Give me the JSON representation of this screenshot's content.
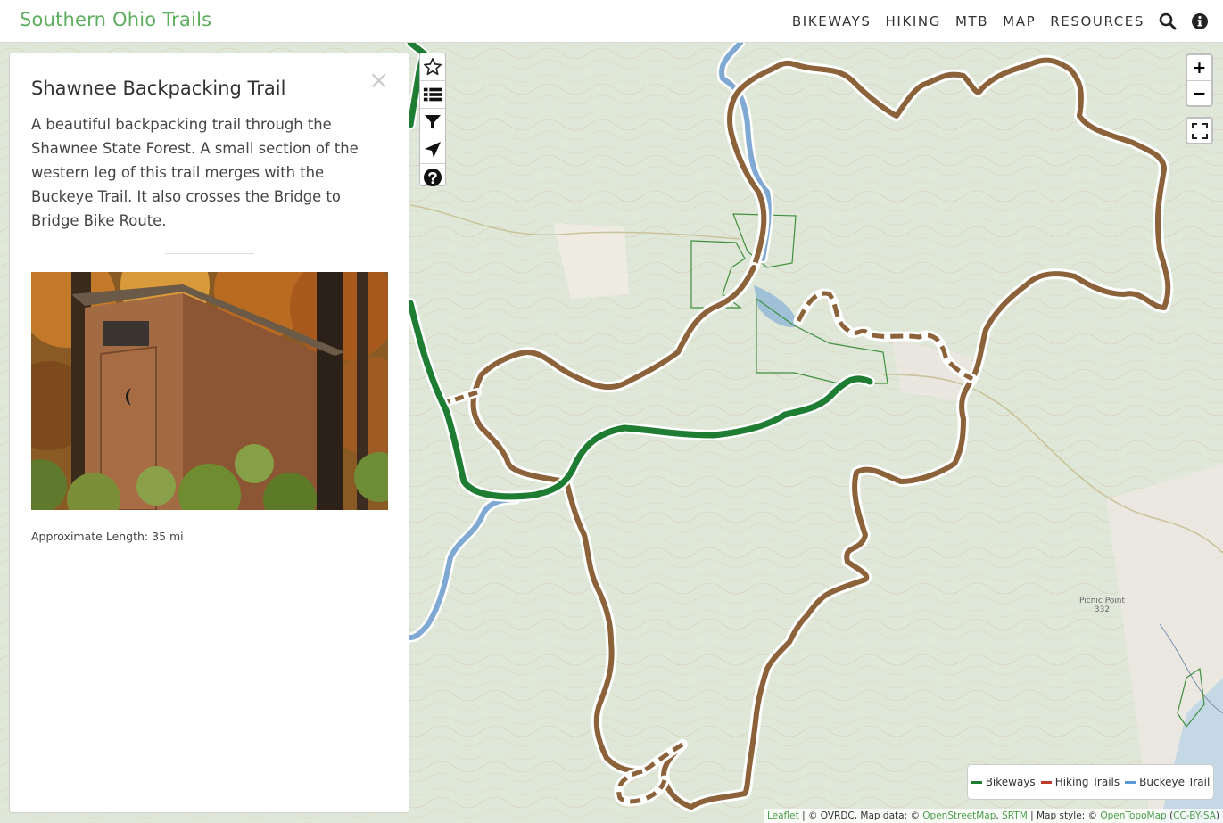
{
  "header": {
    "brand": "Southern Ohio Trails",
    "nav": [
      "BIKEWAYS",
      "HIKING",
      "MTB",
      "MAP",
      "RESOURCES"
    ],
    "icons": [
      "search-icon",
      "info-icon"
    ]
  },
  "panel": {
    "title": "Shawnee Backpacking Trail",
    "close": "×",
    "description": "A beautiful backpacking trail through the Shawnee State Forest. A small section of the western leg of this trail merges with the Buckeye Trail. It also crosses the Bridge to Bridge Bike Route.",
    "length": "Approximate Length: 35 mi",
    "photo_alt": "outhouse-in-forest"
  },
  "toolbar": {
    "icons": [
      "star-icon",
      "list-icon",
      "filter-icon",
      "locate-arrow-icon",
      "help-icon"
    ]
  },
  "zoom": {
    "in": "+",
    "out": "−"
  },
  "legend": {
    "items": [
      {
        "label": "Bikeways",
        "color": "#1e7d32"
      },
      {
        "label": "Hiking Trails",
        "color": "#c0392b"
      },
      {
        "label": "Buckeye Trail",
        "color": "#5b9bd5"
      }
    ]
  },
  "attribution": {
    "leaflet": "Leaflet",
    "sep1": " | © OVRDC, Map data: © ",
    "osm": "OpenStreetMap",
    "comma": ", ",
    "srtm": "SRTM",
    "sep2": " | Map style: © ",
    "otm": "OpenTopoMap",
    "open": " (",
    "cc": "CC-BY-SA",
    "close": ")"
  },
  "map_labels": {
    "picnic": "Picnic Point",
    "picnic_elev": "332"
  },
  "colors": {
    "brand": "#5fae5f",
    "trail": "#8b6239",
    "bikeway": "#1e7d32",
    "buckeye": "#7fa9d2"
  }
}
